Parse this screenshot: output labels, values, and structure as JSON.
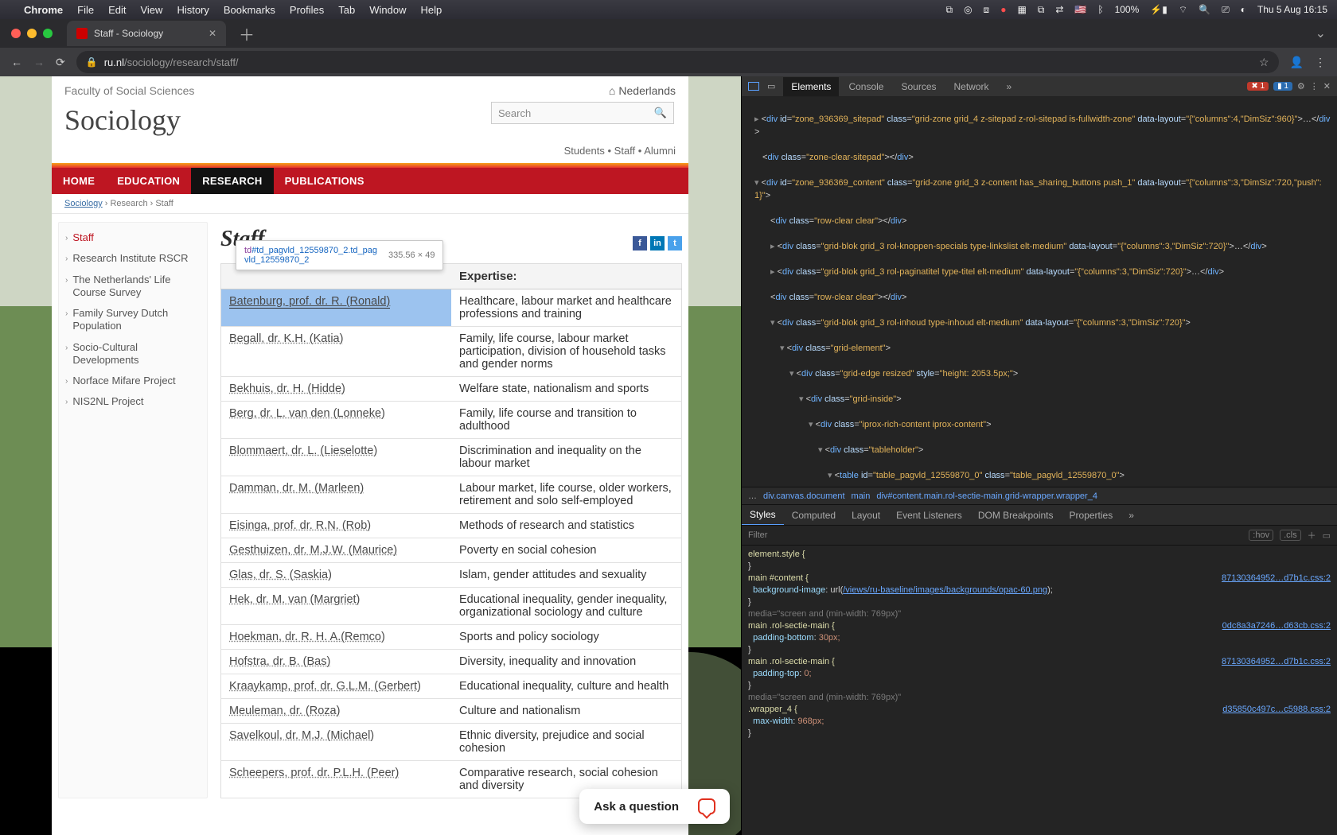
{
  "mac": {
    "app": "Chrome",
    "menus": [
      "File",
      "Edit",
      "View",
      "History",
      "Bookmarks",
      "Profiles",
      "Tab",
      "Window",
      "Help"
    ],
    "battery": "100%",
    "clock": "Thu 5 Aug 16:15"
  },
  "chrome": {
    "tab_title": "Staff - Sociology",
    "url_host": "ru.nl",
    "url_path": "/sociology/research/staff/"
  },
  "site": {
    "faculty": "Faculty of Social Sciences",
    "lang": "Nederlands",
    "dept": "Sociology",
    "search_placeholder": "Search",
    "toplinks": [
      "Students",
      "Staff",
      "Alumni"
    ],
    "nav": [
      "HOME",
      "EDUCATION",
      "RESEARCH",
      "PUBLICATIONS"
    ],
    "nav_active_index": 2,
    "crumbs": [
      "Sociology",
      "Research",
      "Staff"
    ],
    "leftnav": [
      "Staff",
      "Research Institute RSCR",
      "The Netherlands' Life Course Survey",
      "Family Survey Dutch Population",
      "Socio-Cultural Developments",
      "Norface Mifare Project",
      "NIS2NL Project"
    ],
    "page_title": "Staff",
    "table_headers": [
      "",
      "Expertise:"
    ],
    "rows": [
      {
        "name": "Batenburg, prof. dr. R. (Ronald)",
        "exp": "Healthcare, labour market and healthcare professions and training",
        "hl": true
      },
      {
        "name": "Begall, dr. K.H. (Katia)",
        "exp": "Family, life course, labour market participation, division of household tasks and gender norms"
      },
      {
        "name": "Bekhuis, dr. H. (Hidde)",
        "exp": "Welfare state, nationalism and sports"
      },
      {
        "name": "Berg, dr. L. van den (Lonneke)",
        "exp": "Family, life course and transition to adulthood"
      },
      {
        "name": "Blommaert, dr. L. (Lieselotte)",
        "exp": "Discrimination and inequality on the labour market"
      },
      {
        "name": "Damman, dr. M. (Marleen)",
        "exp": "Labour market, life course, older workers, retirement and solo self-employed"
      },
      {
        "name": "Eisinga, prof. dr. R.N. (Rob)",
        "exp": "Methods of research and statistics"
      },
      {
        "name": "Gesthuizen, dr. M.J.W. (Maurice)",
        "exp": "Poverty en social cohesion"
      },
      {
        "name": "Glas, dr. S. (Saskia)",
        "exp": "Islam, gender attitudes and sexuality"
      },
      {
        "name": "Hek, dr. M. van (Margriet)",
        "exp": "Educational inequality, gender inequality, organizational sociology and culture"
      },
      {
        "name": "Hoekman, dr. R. H. A.(Remco)",
        "exp": "Sports and policy sociology"
      },
      {
        "name": "Hofstra, dr. B. (Bas)",
        "exp": "Diversity, inequality and innovation"
      },
      {
        "name": "Kraaykamp, prof. dr. G.L.M. (Gerbert)",
        "exp": "Educational inequality, culture and health"
      },
      {
        "name": "Meuleman, dr. (Roza)",
        "exp": "Culture and nationalism"
      },
      {
        "name": "Savelkoul, dr. M.J. (Michael)",
        "exp": "Ethnic diversity, prejudice and social cohesion"
      },
      {
        "name": "Scheepers, prof. dr. P.L.H. (Peer)",
        "exp": "Comparative research, social cohesion and diversity"
      }
    ],
    "tooltip_selector": "td#td_pagvld_12559870_2.td_pagvld_12559870_2",
    "tooltip_dims": "335.56 × 49",
    "chat_label": "Ask a question"
  },
  "devtools": {
    "tabs": [
      "Elements",
      "Console",
      "Sources",
      "Network"
    ],
    "err_count": "1",
    "warn_count": "1",
    "crumb_segments": [
      "…",
      "div.canvas.document",
      "main",
      "div#content.main.rol-sectie-main.grid-wrapper.wrapper_4"
    ],
    "style_tabs": [
      "Styles",
      "Computed",
      "Layout",
      "Event Listeners",
      "DOM Breakpoints",
      "Properties"
    ],
    "filter_placeholder": "Filter",
    "hov": ":hov",
    "cls": ".cls",
    "rules": [
      {
        "sel": "element.style {",
        "src": "",
        "body": [],
        "close": "}"
      },
      {
        "sel": "main #content {",
        "src": "87130364952…d7b1c.css:2",
        "body": [
          "background-image: url(/views/ru-baseline/images/backgrounds/opac-60.png);"
        ],
        "close": "}"
      },
      {
        "media": "media=\"screen and (min-width: 769px)\""
      },
      {
        "sel": "main .rol-sectie-main {",
        "src": "0dc8a3a7246…d63cb.css:2",
        "body": [
          "padding-bottom: 30px;"
        ],
        "close": "}"
      },
      {
        "sel": "main .rol-sectie-main {",
        "src": "87130364952…d7b1c.css:2",
        "body": [
          "padding-top: 0;"
        ],
        "close": "}"
      },
      {
        "media": "media=\"screen and (min-width: 769px)\""
      },
      {
        "sel": ".wrapper_4 {",
        "src": "d35850c497c…c5988.css:2",
        "body": [
          "max-width: 968px;"
        ],
        "close": "}"
      }
    ]
  }
}
